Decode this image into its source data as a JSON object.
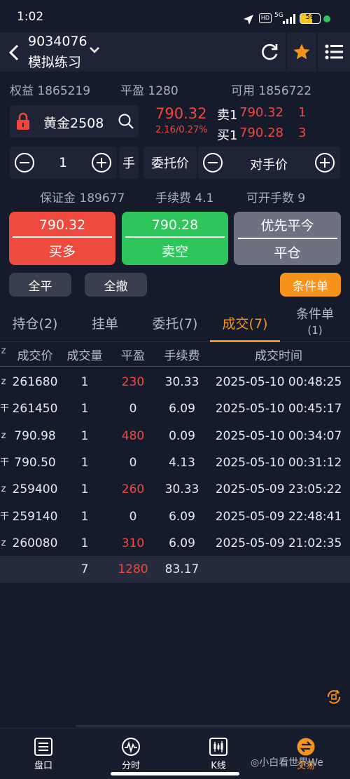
{
  "status": {
    "time": "1:02",
    "network": "5G",
    "battery": "59",
    "hd": "HD"
  },
  "header": {
    "account": "9034076",
    "mode": "模拟练习"
  },
  "account_bar": {
    "equity_label": "权益",
    "equity": "1865219",
    "pnl_label": "平盈",
    "pnl": "1280",
    "available_label": "可用",
    "available": "1856722"
  },
  "instrument": {
    "name": "黄金2508",
    "price": "790.32",
    "change": "2.16/0.27%"
  },
  "quotes": {
    "ask_label": "卖1",
    "ask_price": "790.32",
    "ask_qty": "1",
    "bid_label": "买1",
    "bid_price": "790.28",
    "bid_qty": "3"
  },
  "order": {
    "qty": "1",
    "qty_unit": "手",
    "price_type_label": "委托价",
    "price_type": "对手价"
  },
  "margin_bar": {
    "margin_label": "保证金",
    "margin": "189677",
    "fee_label": "手续费",
    "fee": "4.1",
    "openable_label": "可开手数",
    "openable": "9"
  },
  "actions": {
    "buy_price": "790.32",
    "buy_label": "买多",
    "sell_price": "790.28",
    "sell_label": "卖空",
    "close_top": "优先平今",
    "close_label": "平仓",
    "close_all": "全平",
    "cancel_all": "全撤",
    "conditional": "条件单"
  },
  "tabs": [
    {
      "label": "持仓(2)"
    },
    {
      "label": "挂单"
    },
    {
      "label": "委托(7)"
    },
    {
      "label": "成交(7)"
    },
    {
      "label": "条件单",
      "sub": "(1)"
    }
  ],
  "table": {
    "headers": [
      "成交价",
      "成交量",
      "平盈",
      "手续费",
      "成交时间"
    ],
    "rows": [
      {
        "prefix": "z",
        "price": "261680",
        "qty": "1",
        "pnl": "230",
        "fee": "30.33",
        "time": "2025-05-10 00:48:25"
      },
      {
        "prefix": "干",
        "price": "261450",
        "qty": "1",
        "pnl": "0",
        "fee": "6.09",
        "time": "2025-05-10 00:45:17"
      },
      {
        "prefix": "z",
        "price": "790.98",
        "qty": "1",
        "pnl": "480",
        "fee": "0.09",
        "time": "2025-05-10 00:34:07"
      },
      {
        "prefix": "干",
        "price": "790.50",
        "qty": "1",
        "pnl": "0",
        "fee": "4.13",
        "time": "2025-05-10 00:31:12"
      },
      {
        "prefix": "z",
        "price": "259400",
        "qty": "1",
        "pnl": "260",
        "fee": "30.33",
        "time": "2025-05-09 23:05:22"
      },
      {
        "prefix": "干",
        "price": "259140",
        "qty": "1",
        "pnl": "0",
        "fee": "6.09",
        "time": "2025-05-09 22:48:41"
      },
      {
        "prefix": "z",
        "price": "260080",
        "qty": "1",
        "pnl": "310",
        "fee": "6.09",
        "time": "2025-05-09 21:02:35"
      }
    ],
    "totals": {
      "qty": "7",
      "pnl": "1280",
      "fee": "83.17"
    }
  },
  "nav": [
    {
      "label": "盘口",
      "icon": "list-icon"
    },
    {
      "label": "分时",
      "icon": "pulse-icon"
    },
    {
      "label": "K线",
      "icon": "candlestick-icon"
    },
    {
      "label": "交易",
      "icon": "swap-icon"
    }
  ],
  "watermark": "小白看世界We",
  "colors": {
    "up": "#f0483e",
    "down": "#2fc45a",
    "accent": "#f7931a",
    "bg": "#161b2b"
  }
}
